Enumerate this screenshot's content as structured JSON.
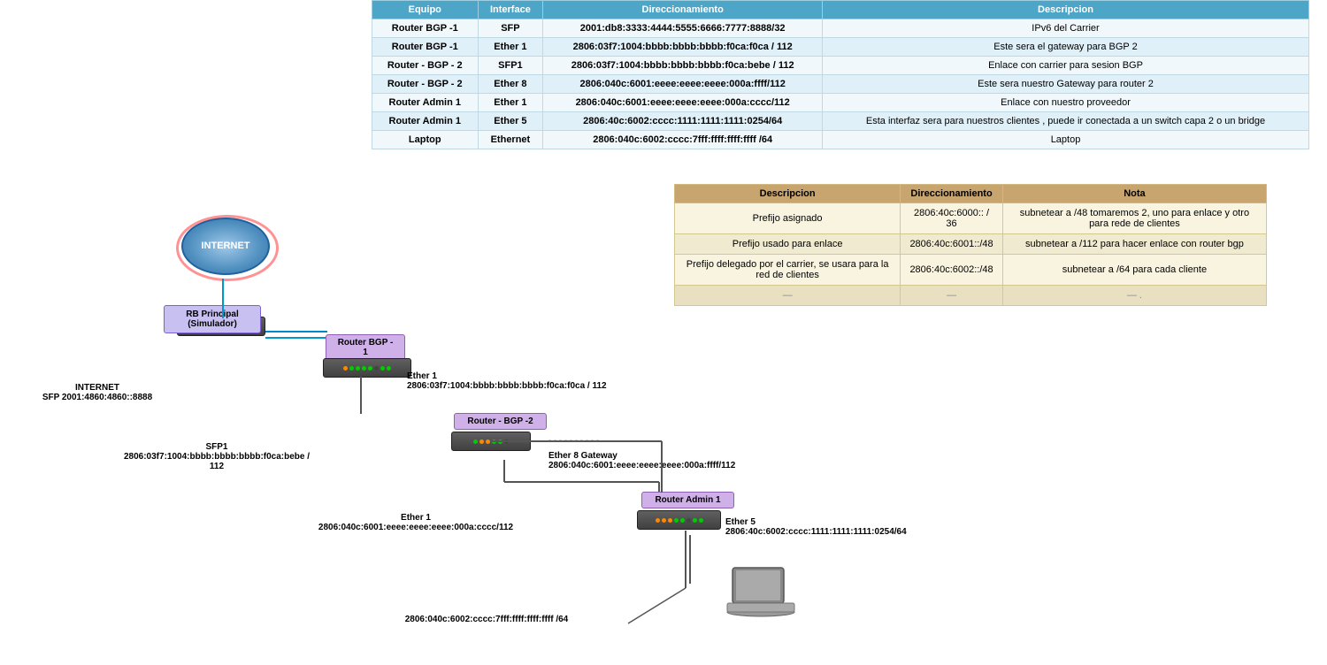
{
  "top_table": {
    "headers": [
      "Equipo",
      "Interface",
      "Direccionamiento",
      "Descripcion"
    ],
    "rows": [
      {
        "equipo": "Router BGP -1",
        "interface": "SFP",
        "direccionamiento": "2001:db8:3333:4444:5555:6666:7777:8888/32",
        "descripcion": "IPv6 del Carrier"
      },
      {
        "equipo": "Router BGP -1",
        "interface": "Ether 1",
        "direccionamiento": "2806:03f7:1004:bbbb:bbbb:bbbb:f0ca:f0ca / 112",
        "descripcion": "Este sera el gateway para BGP 2"
      },
      {
        "equipo": "Router - BGP - 2",
        "interface": "SFP1",
        "direccionamiento": "2806:03f7:1004:bbbb:bbbb:bbbb:f0ca:bebe / 112",
        "descripcion": "Enlace con carrier para sesion BGP"
      },
      {
        "equipo": "Router - BGP - 2",
        "interface": "Ether 8",
        "direccionamiento": "2806:040c:6001:eeee:eeee:eeee:000a:ffff/112",
        "descripcion": "Este sera nuestro Gateway para router 2"
      },
      {
        "equipo": "Router Admin 1",
        "interface": "Ether 1",
        "direccionamiento": "2806:040c:6001:eeee:eeee:eeee:000a:cccc/112",
        "descripcion": "Enlace con nuestro proveedor"
      },
      {
        "equipo": "Router Admin 1",
        "interface": "Ether 5",
        "direccionamiento": "2806:40c:6002:cccc:1111:1111:1111:0254/64",
        "descripcion": "Esta interfaz sera para nuestros clientes , puede ir conectada a un switch capa 2 o un bridge"
      },
      {
        "equipo": "Laptop",
        "interface": "Ethernet",
        "direccionamiento": "2806:040c:6002:cccc:7fff:ffff:ffff:ffff /64",
        "descripcion": "Laptop"
      }
    ]
  },
  "bottom_table": {
    "headers": [
      "Descripcion",
      "Direccionamiento",
      "Nota"
    ],
    "rows": [
      {
        "descripcion": "Prefijo asignado",
        "direccionamiento": "2806:40c:6000:: / 36",
        "nota": "subnetear a /48  tomaremos 2, uno para enlace y otro para rede de clientes"
      },
      {
        "descripcion": "Prefijo usado para enlace",
        "direccionamiento": "2806:40c:6001::/48",
        "nota": "subnetear a /112 para hacer enlace con router bgp"
      },
      {
        "descripcion": "Prefijo delegado por el carrier, se usara para la red de clientes",
        "direccionamiento": "2806:40c:6002::/48",
        "nota": "subnetear a /64 para cada cliente"
      },
      {
        "descripcion": "—",
        "direccionamiento": "—",
        "nota": "— ."
      }
    ]
  },
  "diagram": {
    "internet_label": "INTERNET",
    "rb_principal_label": "RB Principal\n(Simulador)",
    "router_bgp_label": "Router BGP -\n1",
    "router_bgp2_label": "Router - BGP -2",
    "router_admin_label": "Router Admin 1",
    "internet_sfp_label": "INTERNET\nSFP 2001:4860:4860::8888",
    "ether1_bgp1_label": "Ether 1\n2806:03f7:1004:bbbb:bbbb:bbbb:f0ca:f0ca / 112",
    "sfp1_label": "SFP1\n2806:03f7:1004:bbbb:bbbb:bbbb:f0ca:bebe / 112",
    "ether8_label": "Ether 8 Gateway\n2806:040c:6001:eeee:eeee:eeee:000a:ffff/112",
    "ether1_admin_label": "Ether 1\n2806:040c:6001:eeee:eeee:eeee:000a:cccc/112",
    "ether5_label": "Ether 5\n2806:40c:6002:cccc:1111:1111:1111:0254/64",
    "laptop_addr_label": "2806:040c:6002:cccc:7fff:ffff:ffff:ffff /64"
  }
}
